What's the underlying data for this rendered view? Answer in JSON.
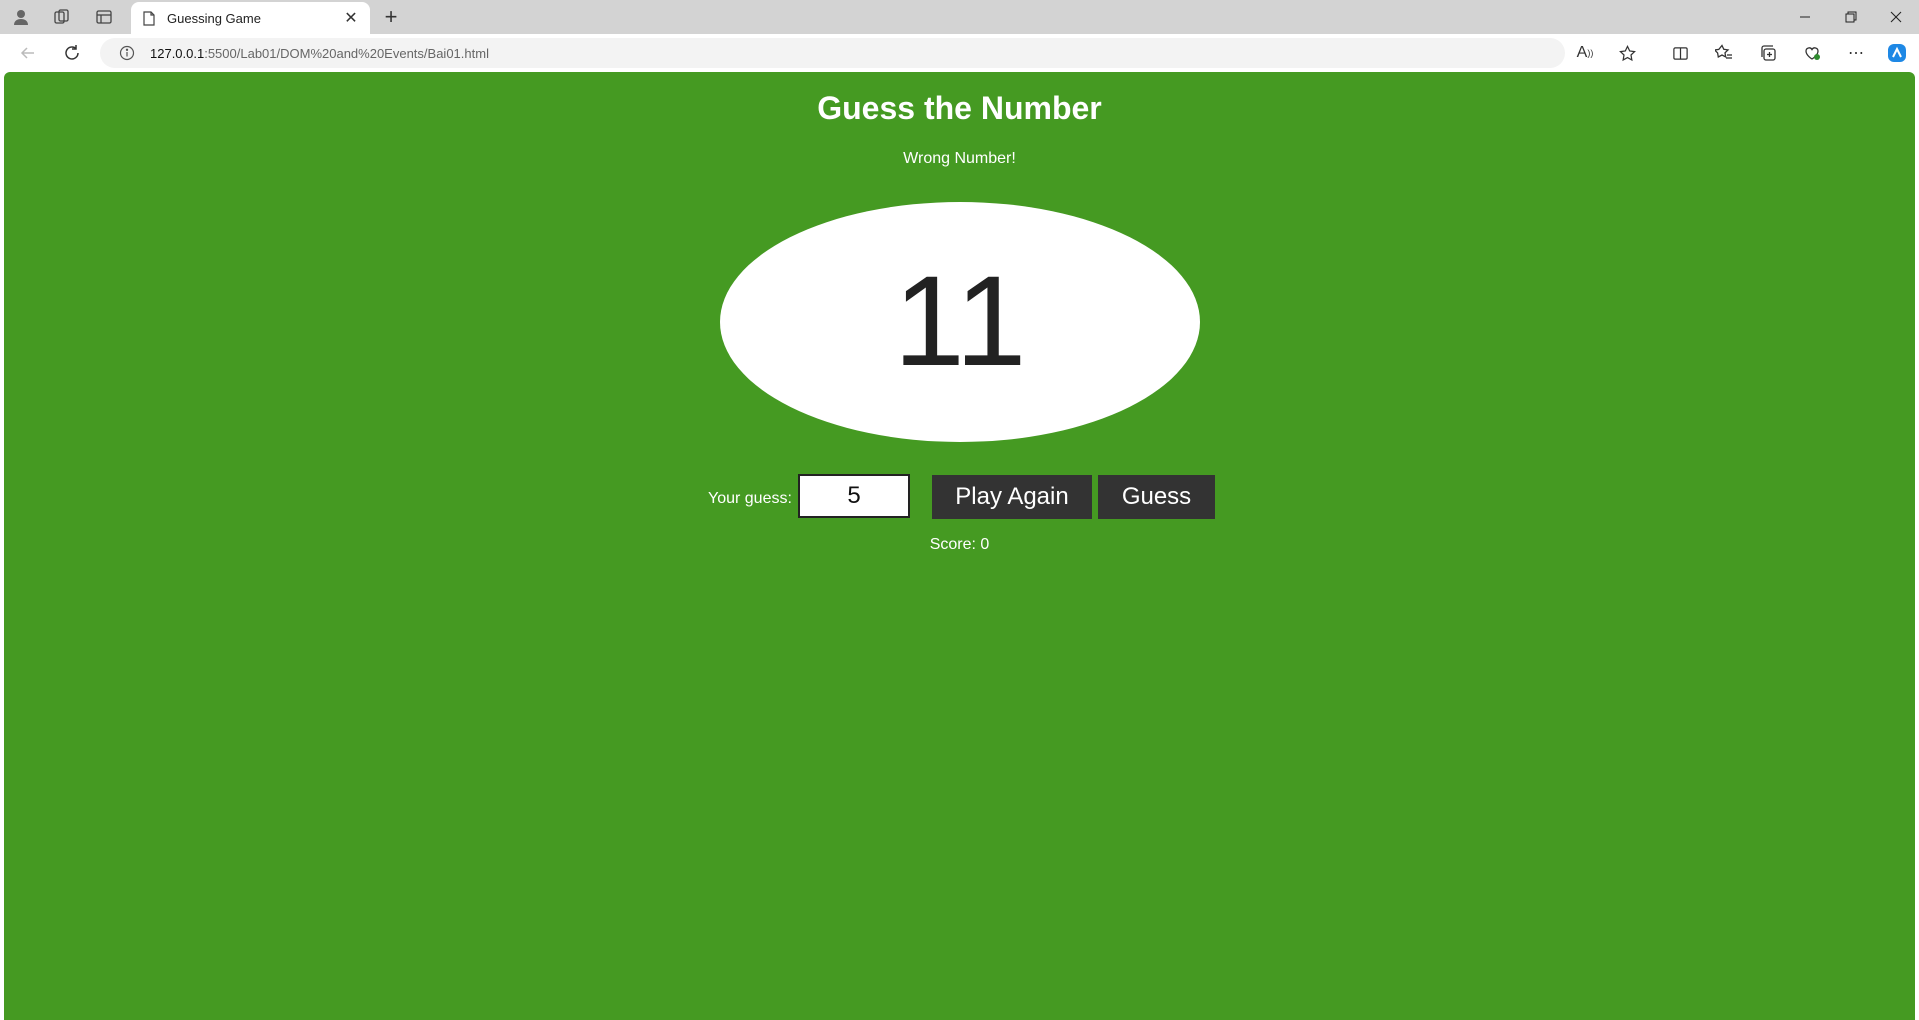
{
  "browser": {
    "tab_title": "Guessing Game",
    "url_host": "127.0.0.1",
    "url_path": ":5500/Lab01/DOM%20and%20Events/Bai01.html"
  },
  "page": {
    "title": "Guess the Number",
    "message": "Wrong Number!",
    "number_display": "11",
    "guess_label": "Your guess:",
    "guess_value": "5",
    "play_again_label": "Play Again",
    "guess_button_label": "Guess",
    "score_text": "Score: 0",
    "background_color": "#459a22"
  }
}
